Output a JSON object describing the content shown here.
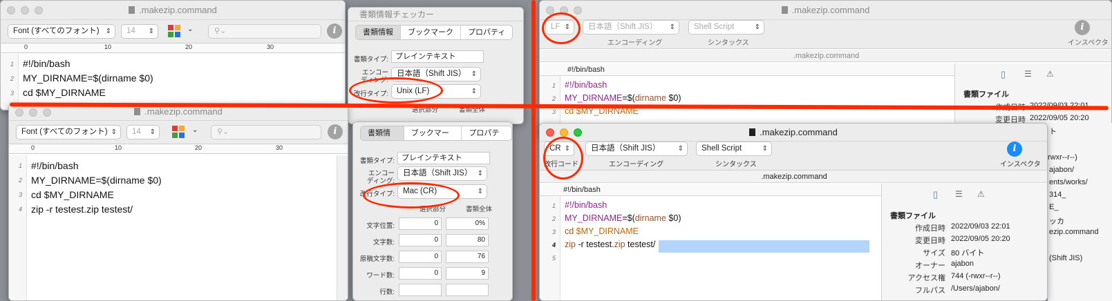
{
  "left_top": {
    "title": ".makezip.command",
    "font_popup": "Font (すべてのフォント)",
    "size_popup": "14",
    "ruler": [
      "0",
      "10",
      "20",
      "30"
    ],
    "lines": [
      "#!/bin/bash",
      "MY_DIRNAME=$(dirname $0)",
      "cd $MY_DIRNAME"
    ],
    "line_numbers": [
      "1",
      "2",
      "3"
    ]
  },
  "left_bottom": {
    "title": ".makezip.command",
    "font_popup": "Font (すべてのフォント)",
    "size_popup": "14",
    "ruler": [
      "0",
      "10",
      "20",
      "30"
    ],
    "lines": [
      "#!/bin/bash",
      "MY_DIRNAME=$(dirname $0)",
      "cd $MY_DIRNAME",
      "zip -r testest.zip testest/"
    ],
    "line_numbers": [
      "1",
      "2",
      "3",
      "4"
    ]
  },
  "checker_top": {
    "title": "書類情報チェッカー",
    "tabs": [
      "書類情報",
      "ブックマーク",
      "プロパティ"
    ],
    "doc_type_label": "書類タイプ:",
    "doc_type": "プレインテキスト",
    "encoding_label_a": "エンコー",
    "encoding_label_b": "ディング:",
    "encoding": "日本語（Shift JIS）",
    "linebreak_label": "改行タイプ:",
    "linebreak": "Unix (LF)",
    "col_selection": "選択部分",
    "col_whole": "書類全体"
  },
  "checker_bottom": {
    "tabs": [
      "書類情報",
      "ブックマーク",
      "プロパティ"
    ],
    "doc_type_label": "書類タイプ:",
    "doc_type": "プレインテキスト",
    "encoding_label_a": "エンコー",
    "encoding_label_b": "ディング:",
    "encoding": "日本語（Shift JIS）",
    "linebreak_label": "改行タイプ:",
    "linebreak": "Mac (CR)",
    "col_selection": "選択部分",
    "col_whole": "書類全体",
    "rows": [
      {
        "label": "文字位置:",
        "sel": "0",
        "whole": "0%"
      },
      {
        "label": "文字数:",
        "sel": "0",
        "whole": "80"
      },
      {
        "label": "原稿文字数:",
        "sel": "0",
        "whole": "76"
      },
      {
        "label": "ワード数:",
        "sel": "0",
        "whole": "9"
      },
      {
        "label": "行数:",
        "sel": "",
        "whole": ""
      }
    ]
  },
  "right_top": {
    "title": ".makezip.command",
    "linebreak": "LF",
    "encoding": "日本語（Shift JIS）",
    "syntax": "Shell Script",
    "encoding_caption": "エンコーディング",
    "syntax_caption": "シンタックス",
    "inspector_caption": "インスペクタ",
    "tabbar": ".makezip.command",
    "nav": "#!/bin/bash",
    "line_numbers": [
      "1",
      "2",
      "3"
    ],
    "l1": "#!/bin/bash",
    "l2a": "MY_DIRNAME",
    "l2b": "=$(",
    "l2c": "dirname",
    "l2d": " $0)",
    "l3": "cd $MY_DIRNAME",
    "pane_heading": "書類ファイル",
    "pane_rows": [
      {
        "k": "作成日時",
        "v": "2022/09/03 22:01"
      },
      {
        "k": "変更日時",
        "v": "2022/09/05 20:20"
      }
    ],
    "pane_extra": [
      "ト",
      "rwxr--r--)",
      "ajabon/",
      "ents/works/",
      "314_",
      "E_",
      "ッカ",
      "ezip.command",
      "(Shift JIS)"
    ]
  },
  "right_bottom": {
    "title": ".makezip.command",
    "linebreak": "CR",
    "linebreak_caption": "改行コード",
    "encoding": "日本語（Shift JIS）",
    "syntax": "Shell Script",
    "encoding_caption": "エンコーディング",
    "syntax_caption": "シンタックス",
    "inspector_caption": "インスペクタ",
    "tabbar": ".makezip.command",
    "nav": "#!/bin/bash",
    "line_numbers": [
      "1",
      "2",
      "3",
      "4",
      "5"
    ],
    "l1": "#!/bin/bash",
    "l2a": "MY_DIRNAME",
    "l2b": "=$(",
    "l2c": "dirname",
    "l2d": " $0)",
    "l3a": "cd",
    "l3b": " $MY_DIRNAME",
    "l4a": "zip",
    "l4b": " -r testest.",
    "l4c": "zip",
    "l4d": " testest/",
    "pane_heading": "書類ファイル",
    "pane_rows": [
      {
        "k": "作成日時",
        "v": "2022/09/03 22:01"
      },
      {
        "k": "変更日時",
        "v": "2022/09/05 20:20"
      },
      {
        "k": "サイズ",
        "v": "80 バイト"
      },
      {
        "k": "オーナー",
        "v": "ajabon"
      },
      {
        "k": "アクセス権",
        "v": "744 (-rwxr--r--)"
      },
      {
        "k": "フルパス",
        "v": "/Users/ajabon/"
      }
    ]
  },
  "colors": {
    "annotation_red": "#ff2a00",
    "selection_blue": "#b3d4fb"
  }
}
